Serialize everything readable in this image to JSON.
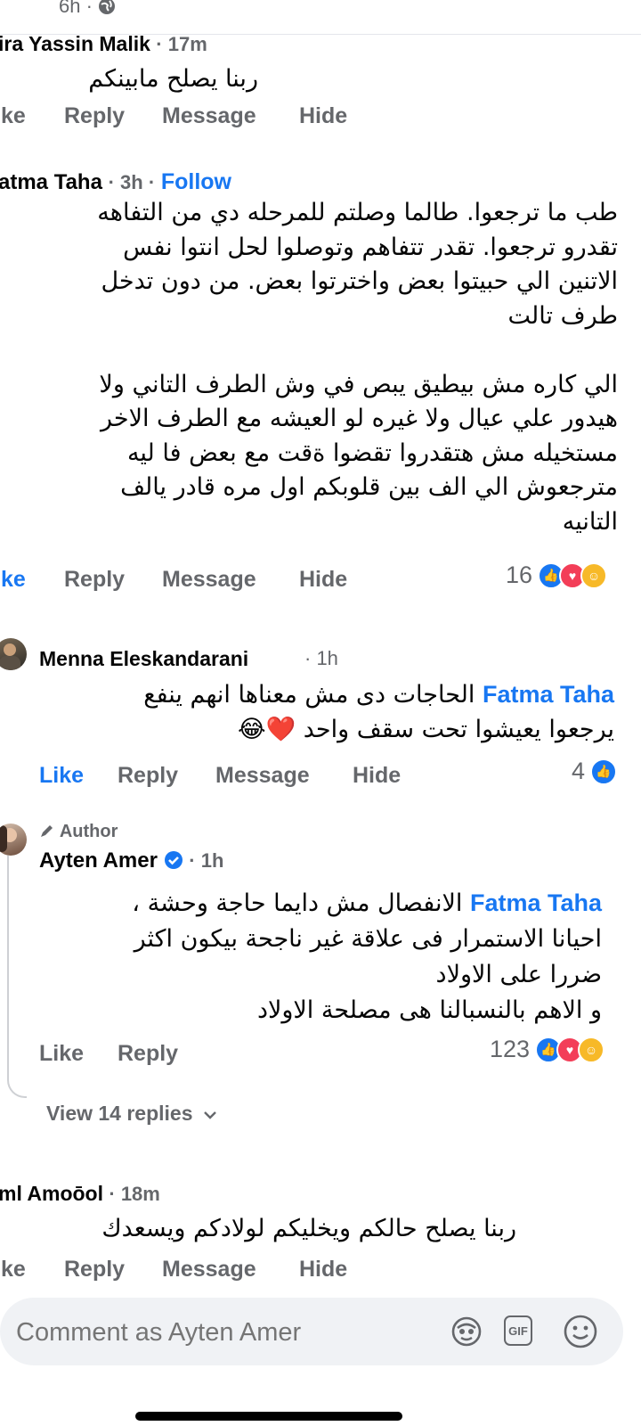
{
  "top": {
    "time": "6h ·"
  },
  "comments": [
    {
      "name": "ira Yassin Malik",
      "meta": "· 17m",
      "text": "ربنا يصلح مابينكم",
      "actions": [
        "ike",
        "Reply",
        "Message",
        "Hide"
      ]
    },
    {
      "name": "atma Taha",
      "meta": "· 3h ·",
      "follow": "Follow",
      "text": "طب ما ترجعوا. طالما وصلتم للمرحله دي من التفاهه\nتقدرو ترجعوا. تقدر تتفاهم وتوصلوا لحل انتوا نفس\nالاتنين الي حبيتوا بعض واخترتوا بعض. من دون تدخل\nطرف تالت\n\nالي كاره مش بيطيق يبص في وش الطرف التاني  ولا\nهيدور علي عيال ولا غيره لو العيشه مع الطرف الاخر\nمستخيله مش هتقدروا تقضوا ةقت مع بعض فا ليه\nمترجعوش الي الف بين قلوبكم اول مره قادر يالف\nالتانيه",
      "actions": [
        "ike",
        "Reply",
        "Message",
        "Hide"
      ],
      "reaction_count": "16"
    },
    {
      "name": "Menna Eleskandarani",
      "meta": "· 1h",
      "mention": "Fatma Taha",
      "text_line1": "الحاجات دى مش معناها انهم ينفع",
      "text_line2": "يرجعوا يعيشوا تحت سقف واحد ❤️😂",
      "actions": [
        "Like",
        "Reply",
        "Message",
        "Hide"
      ],
      "reaction_count": "4"
    },
    {
      "badge": "Author",
      "name": "Ayten Amer",
      "meta": "· 1h",
      "mention": "Fatma Taha",
      "text_line1": "الانفصال مش دايما حاجة وحشة ،",
      "text_rest": "احيانا  الاستمرار فى علاقة غير ناجحة بيكون اكثر\nضررا على الاولاد\nو الاهم  بالنسبالنا هى مصلحة الاولاد",
      "actions": [
        "Like",
        "Reply"
      ],
      "reaction_count": "123",
      "view_replies": "View 14 replies"
    },
    {
      "name": "ml Amoōol",
      "meta": "· 18m",
      "text": "ربنا يصلح حالكم ويخليكم لولادكم ويسعدك",
      "actions": [
        "ike",
        "Reply",
        "Message",
        "Hide"
      ]
    }
  ],
  "composer": {
    "placeholder": "Comment as Ayten Amer",
    "gif_label": "GIF"
  },
  "icons": [
    "globe-icon",
    "like-reaction-icon",
    "love-reaction-icon",
    "care-reaction-icon",
    "verified-badge-icon",
    "pen-icon",
    "chevron-down-icon",
    "avatar-sticker-icon",
    "gif-icon",
    "emoji-icon"
  ]
}
